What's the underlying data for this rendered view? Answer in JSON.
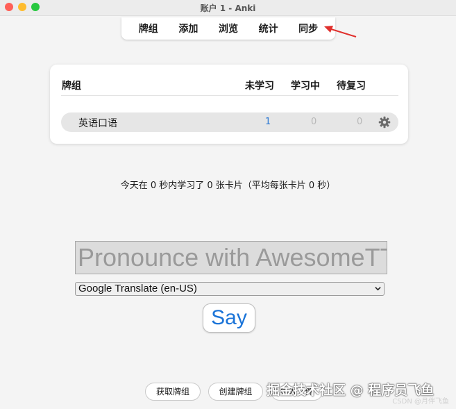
{
  "window": {
    "title": "账户 1 - Anki"
  },
  "nav": {
    "decks": "牌组",
    "add": "添加",
    "browse": "浏览",
    "stats": "统计",
    "sync": "同步"
  },
  "deck_table": {
    "headers": {
      "deck": "牌组",
      "new": "未学习",
      "learn": "学习中",
      "review": "待复习"
    },
    "rows": [
      {
        "name": "英语口语",
        "new": "1",
        "learn": "0",
        "review": "0"
      }
    ]
  },
  "stats_text": "今天在 0 秒内学习了 0 张卡片（平均每张卡片 0 秒）",
  "tts": {
    "input_placeholder": "Pronounce with AwesomeTTS",
    "voice_selected": "Google Translate (en-US)",
    "say_label": "Say"
  },
  "bottom_buttons": {
    "get_shared": "获取牌组",
    "create": "创建牌组",
    "import": "导入文件"
  },
  "watermarks": {
    "main": "掘金技术社区 @ 程序员飞鱼",
    "small": "CSDN @月伴飞鱼"
  },
  "colors": {
    "accent_blue": "#2b78d4",
    "annotation_red": "#e0302d",
    "muted_count": "#b8b8b8"
  },
  "icons": {
    "deck_options": "gear-icon",
    "select_arrow": "chevron-down-icon",
    "annotation": "arrow-icon"
  }
}
